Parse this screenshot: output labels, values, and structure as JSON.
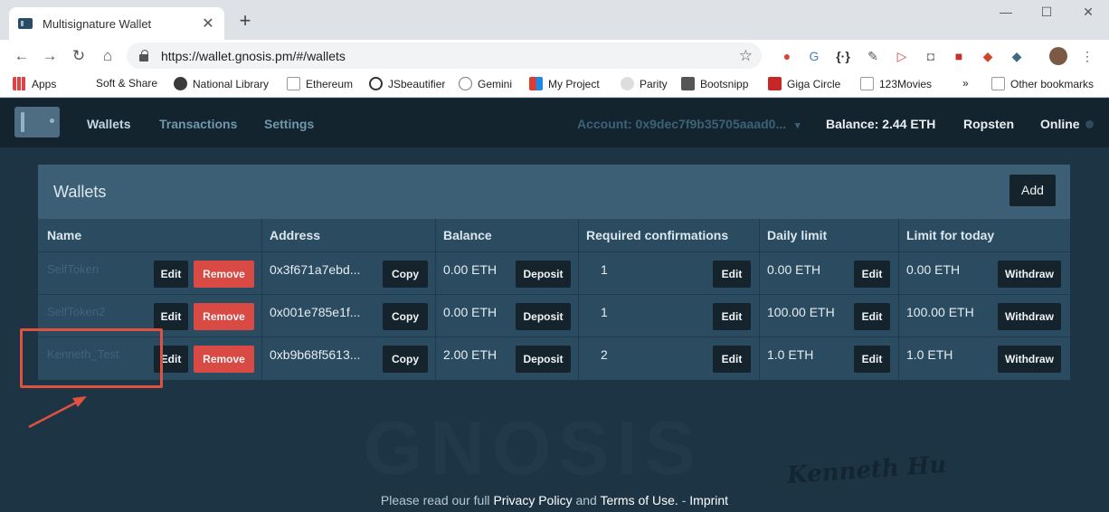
{
  "browser": {
    "tab_title": "Multisignature Wallet",
    "tab_close": "✕",
    "new_tab": "+",
    "win_minimize": "—",
    "win_maximize": "☐",
    "win_close": "✕",
    "url": "https://wallet.gnosis.pm/#/wallets",
    "bookmarks": [
      "Apps",
      "Soft & Share",
      "National Library",
      "Ethereum",
      "JSbeautifier",
      "Gemini",
      "My Project",
      "Parity",
      "Bootsnipp",
      "Giga Circle",
      "123Movies",
      "»",
      "Other bookmarks"
    ]
  },
  "nav": {
    "links": [
      "Wallets",
      "Transactions",
      "Settings"
    ],
    "account": "Account: 0x9dec7f9b35705aaad0...",
    "account_caret": "▾",
    "balance": "Balance: 2.44 ETH",
    "network": "Ropsten",
    "status": "Online"
  },
  "panel": {
    "title": "Wallets",
    "add_label": "Add",
    "headers": [
      "Name",
      "Address",
      "Balance",
      "Required confirmations",
      "Daily limit",
      "Limit for today"
    ],
    "rows": [
      {
        "name": "SelfToken",
        "address": "0x3f671a7ebd...",
        "balance": "0.00 ETH",
        "confirmations": "1",
        "daily_limit": "0.00 ETH",
        "limit_today": "0.00 ETH"
      },
      {
        "name": "SelfToken2",
        "address": "0x001e785e1f...",
        "balance": "0.00 ETH",
        "confirmations": "1",
        "daily_limit": "100.00 ETH",
        "limit_today": "100.00 ETH"
      },
      {
        "name": "Kenneth_Test",
        "address": "0xb9b68f5613...",
        "balance": "2.00 ETH",
        "confirmations": "2",
        "daily_limit": "1.0 ETH",
        "limit_today": "1.0 ETH"
      }
    ],
    "buttons": {
      "edit": "Edit",
      "remove": "Remove",
      "copy": "Copy",
      "deposit": "Deposit",
      "withdraw": "Withdraw"
    }
  },
  "watermark": "GNOSIS",
  "signature": "Kenneth Hu",
  "footer": {
    "prefix": "Please read our full",
    "privacy": "Privacy Policy",
    "and": "and",
    "terms": "Terms of Use.",
    "dash": "-",
    "imprint": "Imprint"
  },
  "colors": {
    "annotation": "#e0523f",
    "remove_button": "#d84a43",
    "nav_bg": "#14242f"
  }
}
